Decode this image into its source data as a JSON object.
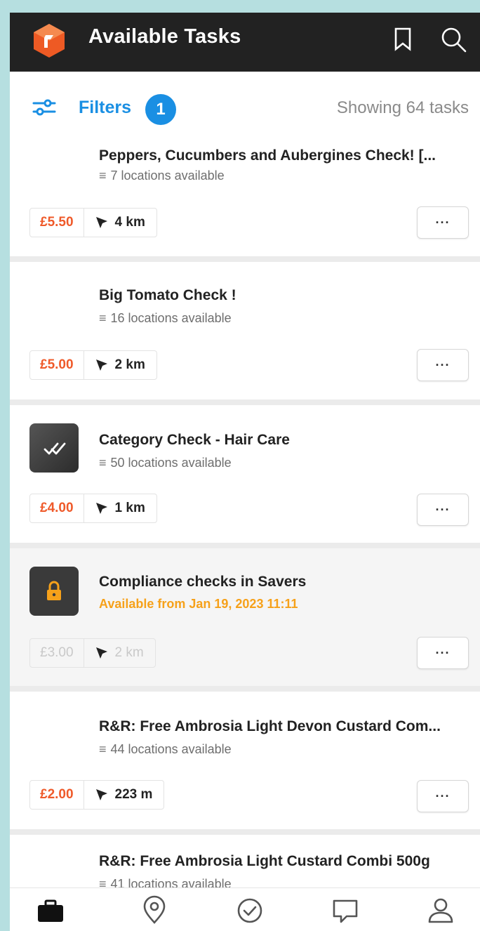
{
  "header": {
    "title": "Available Tasks",
    "logo_icon": "app-logo-icon",
    "bookmark_icon": "bookmark-icon",
    "search_icon": "search-icon",
    "background": "#222222"
  },
  "filters": {
    "label": "Filters",
    "badge_count": "1",
    "showing_text": "Showing 64 tasks",
    "accent_color": "#1a8fe3"
  },
  "tasks": [
    {
      "title": "Peppers, Cucumbers and Aubergines Check! [...",
      "subtitle": "7 locations available",
      "price": "£5.50",
      "distance": "4 km",
      "more_label": "···",
      "locked": false
    },
    {
      "title": "Big Tomato Check !",
      "subtitle": "16 locations available",
      "price": "£5.00",
      "distance": "2 km",
      "more_label": "···",
      "locked": false
    },
    {
      "title": "Category Check - Hair Care",
      "subtitle": "50 locations available",
      "price": "£4.00",
      "distance": "1 km",
      "more_label": "···",
      "icon": "double-check-icon",
      "locked": false
    },
    {
      "title": "Compliance checks in Savers",
      "subtitle": "Available from Jan 19, 2023 11:11",
      "price": "£3.00",
      "distance": "2 km",
      "more_label": "···",
      "icon": "lock-icon",
      "locked": true
    },
    {
      "title": "R&R: Free Ambrosia  Light Devon Custard Com...",
      "subtitle": "44 locations available",
      "price": "£2.00",
      "distance": "223 m",
      "more_label": "···",
      "locked": false
    },
    {
      "title": "R&R: Free Ambrosia  Light Custard Combi 500g",
      "subtitle": "41 locations available",
      "locked": false
    }
  ],
  "bottom_nav": [
    {
      "icon": "briefcase-icon",
      "active": true
    },
    {
      "icon": "location-pin-icon",
      "active": false
    },
    {
      "icon": "check-circle-icon",
      "active": false
    },
    {
      "icon": "chat-bubble-icon",
      "active": false
    },
    {
      "icon": "profile-icon",
      "active": false
    }
  ],
  "colors": {
    "price": "#ef5a2a",
    "available_from": "#f6a11a",
    "page_background": "#b6dfe0"
  }
}
